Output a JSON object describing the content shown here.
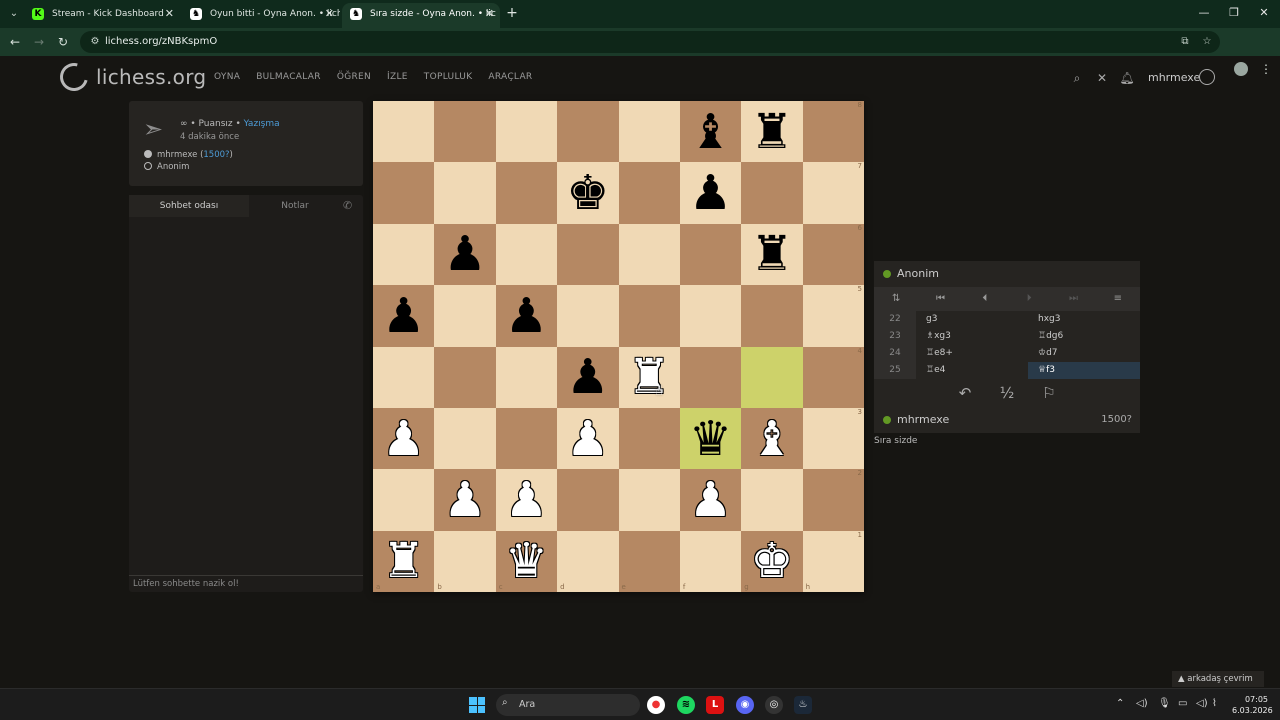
{
  "browser": {
    "tabs": [
      {
        "title": "Stream - Kick Dashboard",
        "icon": "K"
      },
      {
        "title": "Oyun bitti - Oyna Anon. • liches",
        "icon": "♞"
      },
      {
        "title": "Sıra sizde - Oyna Anon. • lic",
        "icon": "♞"
      }
    ],
    "url": "lichess.org/zNBKspmO"
  },
  "header": {
    "logo": "lichess.org",
    "nav": [
      "OYNA",
      "BULMACALAR",
      "ÖĞREN",
      "İZLE",
      "TOPLULUK",
      "ARAÇLAR"
    ],
    "username": "mhrmexe"
  },
  "game_info": {
    "mode_prefix": "∞ • Puansız • ",
    "mode_link": "Yazışma",
    "time_ago": "4 dakika önce",
    "white_name": "mhrmexe (",
    "white_rating": "1500?",
    "white_close": ")",
    "black_name": "Anonim"
  },
  "chat": {
    "tab_room": "Sohbet odası",
    "tab_notes": "Notlar",
    "placeholder": "Lütfen sohbette nazik ol!"
  },
  "board": {
    "ranks": [
      "8",
      "7",
      "6",
      "5",
      "4",
      "3",
      "2",
      "1"
    ],
    "files": [
      "a",
      "b",
      "c",
      "d",
      "e",
      "f",
      "g",
      "h"
    ],
    "rows": [
      [
        "",
        "",
        "",
        "",
        "",
        "b:♝",
        "b:♜",
        ""
      ],
      [
        "",
        "",
        "",
        "b:♚",
        "",
        "b:♟",
        "",
        ""
      ],
      [
        "",
        "b:♟",
        "",
        "",
        "",
        "",
        "b:♜",
        ""
      ],
      [
        "b:♟",
        "",
        "b:♟",
        "",
        "",
        "",
        "",
        ""
      ],
      [
        "",
        "",
        "",
        "b:♟",
        "w:♜",
        "",
        "",
        ""
      ],
      [
        "w:♟",
        "",
        "",
        "w:♟",
        "",
        "b:♛",
        "w:♝",
        ""
      ],
      [
        "",
        "w:♟",
        "w:♟",
        "",
        "",
        "w:♟",
        "",
        ""
      ],
      [
        "w:♜",
        "",
        "w:♛",
        "",
        "",
        "",
        "w:♚",
        ""
      ]
    ],
    "last_move": [
      "g4",
      "f3"
    ]
  },
  "opponent": {
    "name": "Anonim"
  },
  "player": {
    "name": "mhrmexe",
    "rating": "1500?"
  },
  "moves": [
    {
      "no": "22",
      "white": "g3",
      "black": "hxg3"
    },
    {
      "no": "23",
      "white": "♗xg3",
      "black": "♖dg6"
    },
    {
      "no": "24",
      "white": "♖e8+",
      "black": "♔d7"
    },
    {
      "no": "25",
      "white": "♖e4",
      "black": "♕f3"
    }
  ],
  "status": "Sıra sizde",
  "friends": "arkadaş çevrim içi",
  "taskbar": {
    "search_placeholder": "Ara",
    "time": "07:05",
    "date": "6.03.2026"
  }
}
